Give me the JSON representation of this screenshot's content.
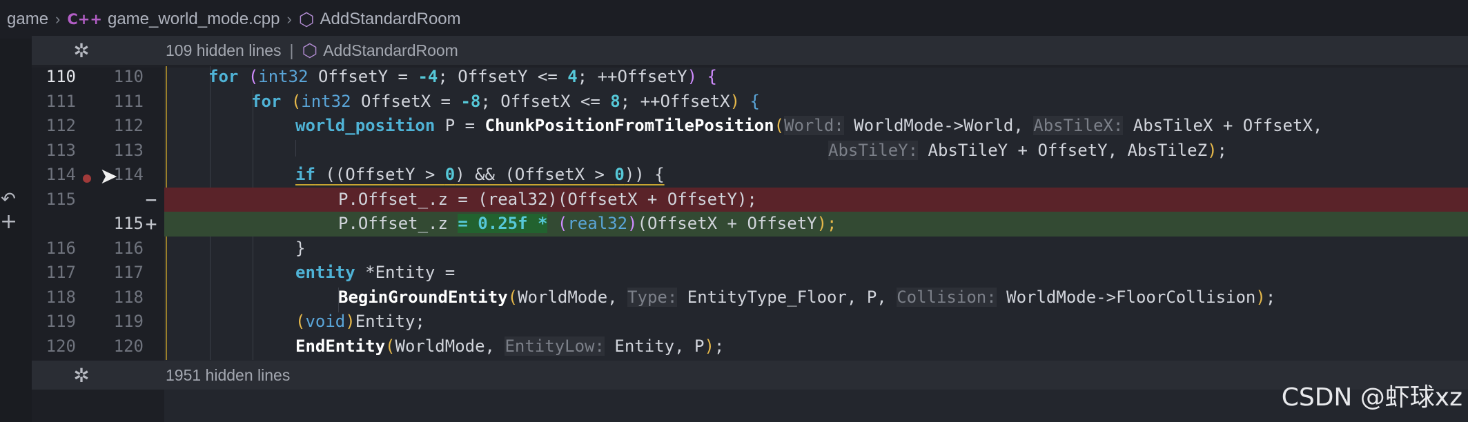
{
  "breadcrumb": {
    "folder": "game",
    "file_lang_badge": "C++",
    "file": "game_world_mode.cpp",
    "symbol": "AddStandardRoom"
  },
  "fold_top": {
    "text": "109 hidden lines",
    "separator": "|",
    "symbol": "AddStandardRoom"
  },
  "fold_bottom": {
    "text": "1951 hidden lines"
  },
  "gutter": {
    "rows": [
      {
        "old": "110",
        "new": "110"
      },
      {
        "old": "111",
        "new": "111"
      },
      {
        "old": "112",
        "new": "112"
      },
      {
        "old": "113",
        "new": "113"
      },
      {
        "old": "114",
        "new": "114"
      },
      {
        "old": "115",
        "new": "",
        "mark": "−"
      },
      {
        "old": "",
        "new": "115",
        "mark": "+"
      },
      {
        "old": "116",
        "new": "116"
      },
      {
        "old": "117",
        "new": "117"
      },
      {
        "old": "118",
        "new": "118"
      },
      {
        "old": "119",
        "new": "119"
      },
      {
        "old": "120",
        "new": "120"
      }
    ]
  },
  "code": {
    "l110": {
      "kw_for": "for",
      "p1": "(",
      "ty": "int32",
      "a": " OffsetY = ",
      "n1": "-4",
      "b": "; OffsetY <= ",
      "n2": "4",
      "c": "; ++OffsetY",
      "p2": ")",
      "d": " {"
    },
    "l111": {
      "kw_for": "for",
      "p1": "(",
      "ty": "int32",
      "a": " OffsetX = ",
      "n1": "-8",
      "b": "; OffsetX <= ",
      "n2": "8",
      "c": "; ++OffsetX",
      "p2": ")",
      "d": " {"
    },
    "l112": {
      "ty": "world_position",
      "a": " P = ",
      "fn": "ChunkPositionFromTilePosition",
      "p1": "(",
      "h1": "World:",
      "b": " WorldMode->World, ",
      "h2": "AbsTileX:",
      "c": " AbsTileX + OffsetX,"
    },
    "l113": {
      "h3": "AbsTileY:",
      "a": " AbsTileY + OffsetY, AbsTileZ",
      "p2": ")",
      "b": ";"
    },
    "l114": {
      "kw": "if",
      "a": " ((OffsetY > ",
      "n1": "0",
      "b": ") && (OffsetX > ",
      "n2": "0",
      "c": ")) {"
    },
    "l115_old": {
      "a": "P.Offset_.z = (real32)(OffsetX + OffsetY);"
    },
    "l115_new": {
      "a": "P.Offset_.z ",
      "eq": "= 0.25f *",
      "b": " ",
      "p1": "(",
      "ty": "real32",
      "p2": ")",
      "c": "(OffsetX + OffsetY",
      ";": ");"
    },
    "l116": {
      "a": "}"
    },
    "l117": {
      "ty": "entity",
      "a": " *Entity ="
    },
    "l118": {
      "fn": "BeginGroundEntity",
      "p1": "(",
      "a": "WorldMode, ",
      "h1": "Type:",
      "b": " EntityType_Floor, P, ",
      "h2": "Collision:",
      "c": " WorldMode->FloorCollision",
      "p2": ")",
      "d": ";"
    },
    "l119": {
      "p1": "(",
      "ty": "void",
      "p2": ")",
      "a": "Entity;"
    },
    "l120": {
      "fn": "EndEntity",
      "p1": "(",
      "a": "WorldMode, ",
      "h1": "EntityLow:",
      "b": " Entity, P",
      "p2": ")",
      "c": ";"
    }
  },
  "watermark": "CSDN @虾球xz",
  "colors": {
    "removed_bg": "#5a2329",
    "added_bg": "#334a33",
    "keyword": "#4fb3d6",
    "hint": "#7c8089"
  },
  "icons": {
    "unfold": "unfold-icon",
    "symbol": "cube-icon",
    "breakpoint": "breakpoint-icon",
    "cursor": "mouse-cursor-icon",
    "revert": "revert-icon",
    "add": "plus-icon"
  }
}
